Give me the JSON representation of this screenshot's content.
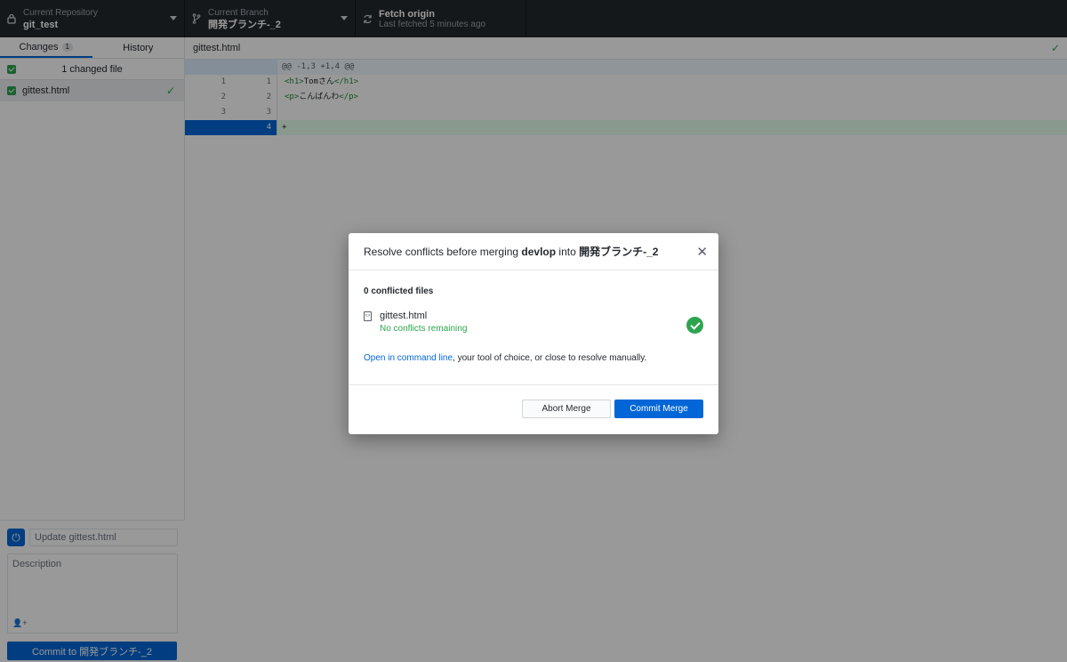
{
  "toolbar": {
    "repo_label": "Current Repository",
    "repo_name": "git_test",
    "branch_label": "Current Branch",
    "branch_name": "開発ブランチ-_2",
    "fetch_label": "Fetch origin",
    "fetch_status": "Last fetched 5 minutes ago"
  },
  "sidebar": {
    "tabs": [
      {
        "label": "Changes",
        "count": "1"
      },
      {
        "label": "History"
      }
    ],
    "changed_files_label": "1 changed file",
    "files": [
      {
        "name": "gittest.html"
      }
    ],
    "commit": {
      "summary_placeholder": "Update gittest.html",
      "description_placeholder": "Description",
      "commit_button": "Commit to 開発ブランチ-_2"
    }
  },
  "diff": {
    "filename": "gittest.html",
    "hunk": "@@ -1,3 +1,4 @@",
    "lines": [
      {
        "old": "1",
        "new": "1",
        "open_tag": "<h1>",
        "text": "Tomさん",
        "close_tag": "</h1>"
      },
      {
        "old": "2",
        "new": "2",
        "open_tag": "<p>",
        "text": "こんばんわ",
        "close_tag": "</p>"
      },
      {
        "old": "3",
        "new": "3",
        "open_tag": "",
        "text": "",
        "close_tag": ""
      },
      {
        "old": "",
        "new": "4",
        "text": "+"
      }
    ]
  },
  "dialog": {
    "title_prefix": "Resolve conflicts before merging ",
    "source_branch": "devlop",
    "title_mid": " into ",
    "target_branch": "開発ブランチ-_2",
    "conflicted_count": "0 conflicted files",
    "file_name": "gittest.html",
    "file_status": "No conflicts remaining",
    "instruction_link": "Open in command line",
    "instruction_rest": ", your tool of choice, or close to resolve manually.",
    "abort_button": "Abort Merge",
    "commit_button": "Commit Merge"
  }
}
